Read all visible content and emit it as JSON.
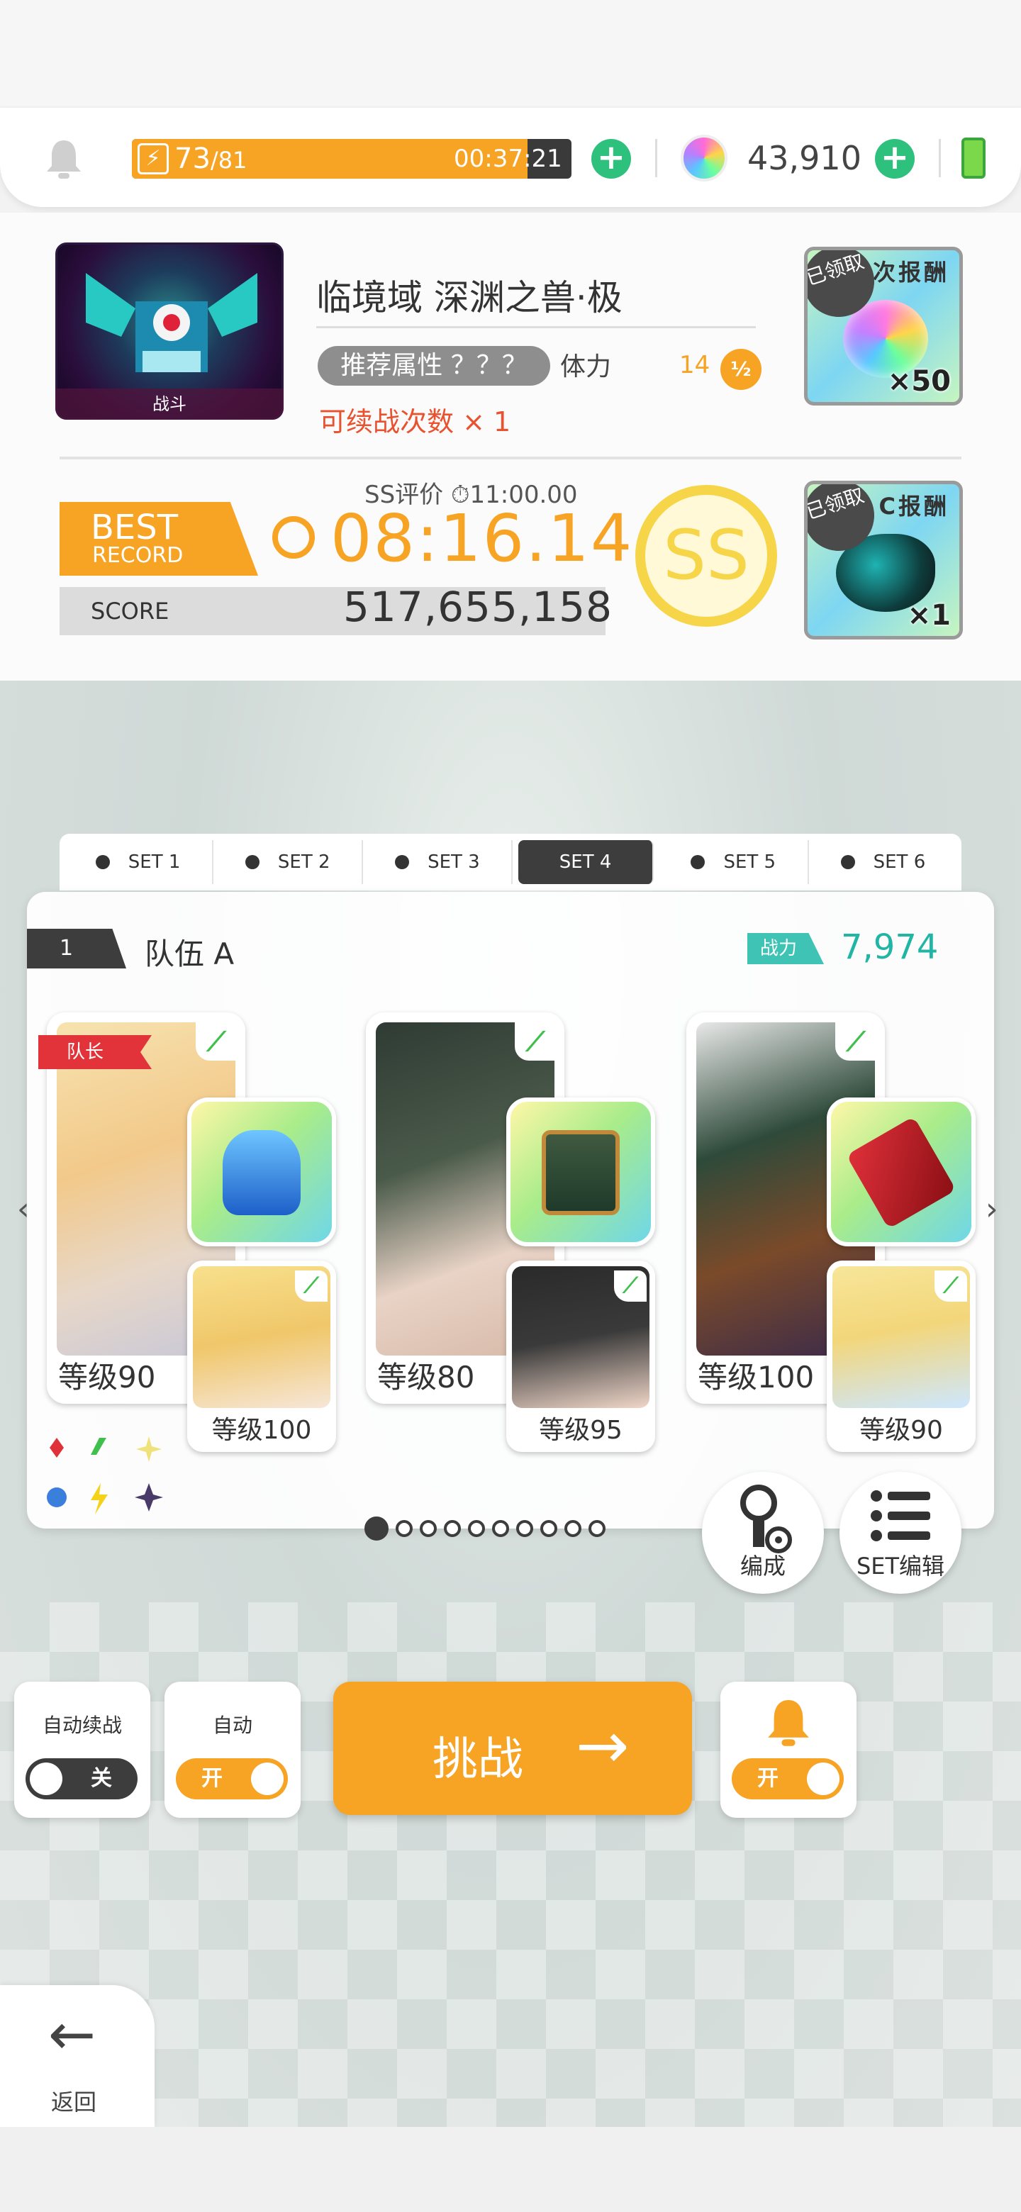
{
  "top_bar": {
    "stamina_current": "73",
    "stamina_max": "/81",
    "stamina_fraction": 0.9,
    "stamina_timer": "00:37:21",
    "gems": "43,910"
  },
  "quest": {
    "thumb_label": "战斗",
    "title": "临境域 深渊之兽·极",
    "recommended_attr": "推荐属性 ？？？",
    "stamina_label": "体力",
    "stamina_cost": "14",
    "half_icon": "½",
    "continue_count": "可续战次数 × 1",
    "rewards": [
      {
        "title": "次报酬",
        "status": "已领取",
        "qty": "×50",
        "icon": "rainbow-gem-icon"
      },
      {
        "title": "C报酬",
        "status": "已领取",
        "qty": "×1",
        "icon": "dark-orb-icon"
      }
    ]
  },
  "record": {
    "best": "BEST",
    "record": "RECORD",
    "ss_eval": "SS评价 ⏱11:00.00",
    "best_time": "08:16.14",
    "score_label": "SCORE",
    "score_value": "517,655,158",
    "rank": "SS"
  },
  "sets": {
    "tabs": [
      "SET 1",
      "SET 2",
      "SET 3",
      "SET 4",
      "SET 5",
      "SET 6"
    ],
    "active_index": 3
  },
  "team": {
    "number": "1",
    "name": "队伍 A",
    "power_label": "战力",
    "power_value": "7,974",
    "leader_label": "队长",
    "units": [
      {
        "level": "等级90",
        "sub_level": "等级100"
      },
      {
        "level": "等级80",
        "sub_level": "等级95"
      },
      {
        "level": "等级100",
        "sub_level": "等级90"
      }
    ],
    "page_count": 10,
    "page_active": 0
  },
  "buttons": {
    "formation": "编成",
    "set_edit": "SET编辑",
    "auto_continue_label": "自动续战",
    "auto_continue_state": "关",
    "auto_label": "自动",
    "auto_state": "开",
    "notify_state": "开",
    "challenge": "挑战",
    "back": "返回"
  },
  "colors": {
    "accent": "#f7a324",
    "power": "#21b5a6",
    "element_green": "#3fbf4c",
    "danger": "#e9522f"
  }
}
